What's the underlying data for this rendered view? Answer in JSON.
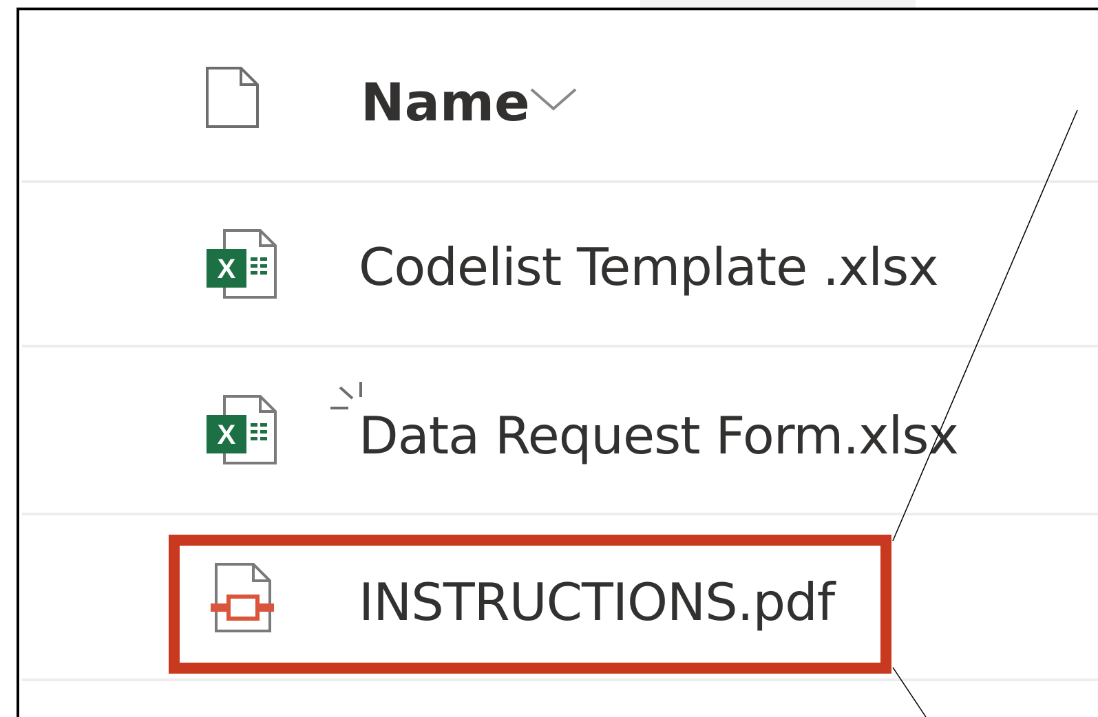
{
  "file_list": {
    "header": {
      "name_column_label": "Name",
      "header_icon": "document-icon",
      "sort_icon": "chevron-down-icon"
    },
    "rows": [
      {
        "name": "Codelist Template .xlsx",
        "icon": "excel-file-icon",
        "highlighted": false,
        "new_indicator": false
      },
      {
        "name": "Data Request Form.xlsx",
        "icon": "excel-file-icon",
        "highlighted": false,
        "new_indicator": true
      },
      {
        "name": "INSTRUCTIONS.pdf",
        "icon": "pdf-file-icon",
        "highlighted": true,
        "new_indicator": false
      }
    ]
  },
  "colors": {
    "highlight": "#c8391f",
    "excel_green": "#1d7044",
    "text": "#323130",
    "divider": "#ededed"
  }
}
